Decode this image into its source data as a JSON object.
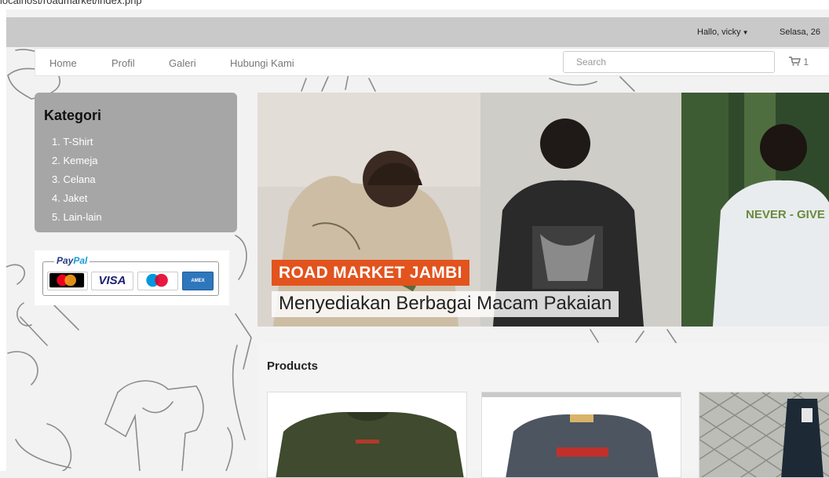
{
  "browser": {
    "url": "localhost/roadmarket/index.php"
  },
  "header": {
    "greeting": "Hallo, vicky",
    "date": "Selasa, 26"
  },
  "nav": {
    "items": [
      {
        "label": "Home"
      },
      {
        "label": "Profil"
      },
      {
        "label": "Galeri"
      },
      {
        "label": "Hubungi Kami"
      }
    ],
    "search_placeholder": "Search",
    "cart_count": "1",
    "cart_icon": "cart-icon"
  },
  "sidebar": {
    "title": "Kategori",
    "categories": [
      "1. T-Shirt",
      "2. Kemeja",
      "3. Celana",
      "4. Jaket",
      "5. Lain-lain"
    ],
    "payment": {
      "brand": "PayPal",
      "cards": [
        "MasterCard",
        "VISA",
        "Maestro",
        "American Express"
      ]
    }
  },
  "banner": {
    "title": "ROAD MARKET JAMBI",
    "subtitle": "Menyediakan Berbagai Macam Pakaian",
    "shirt_text": "NEVER - GIVE"
  },
  "products": {
    "heading": "Products"
  },
  "colors": {
    "accent": "#e2531e",
    "header_bar": "#c9c9c9",
    "sidebar_panel": "#a6a6a6"
  }
}
